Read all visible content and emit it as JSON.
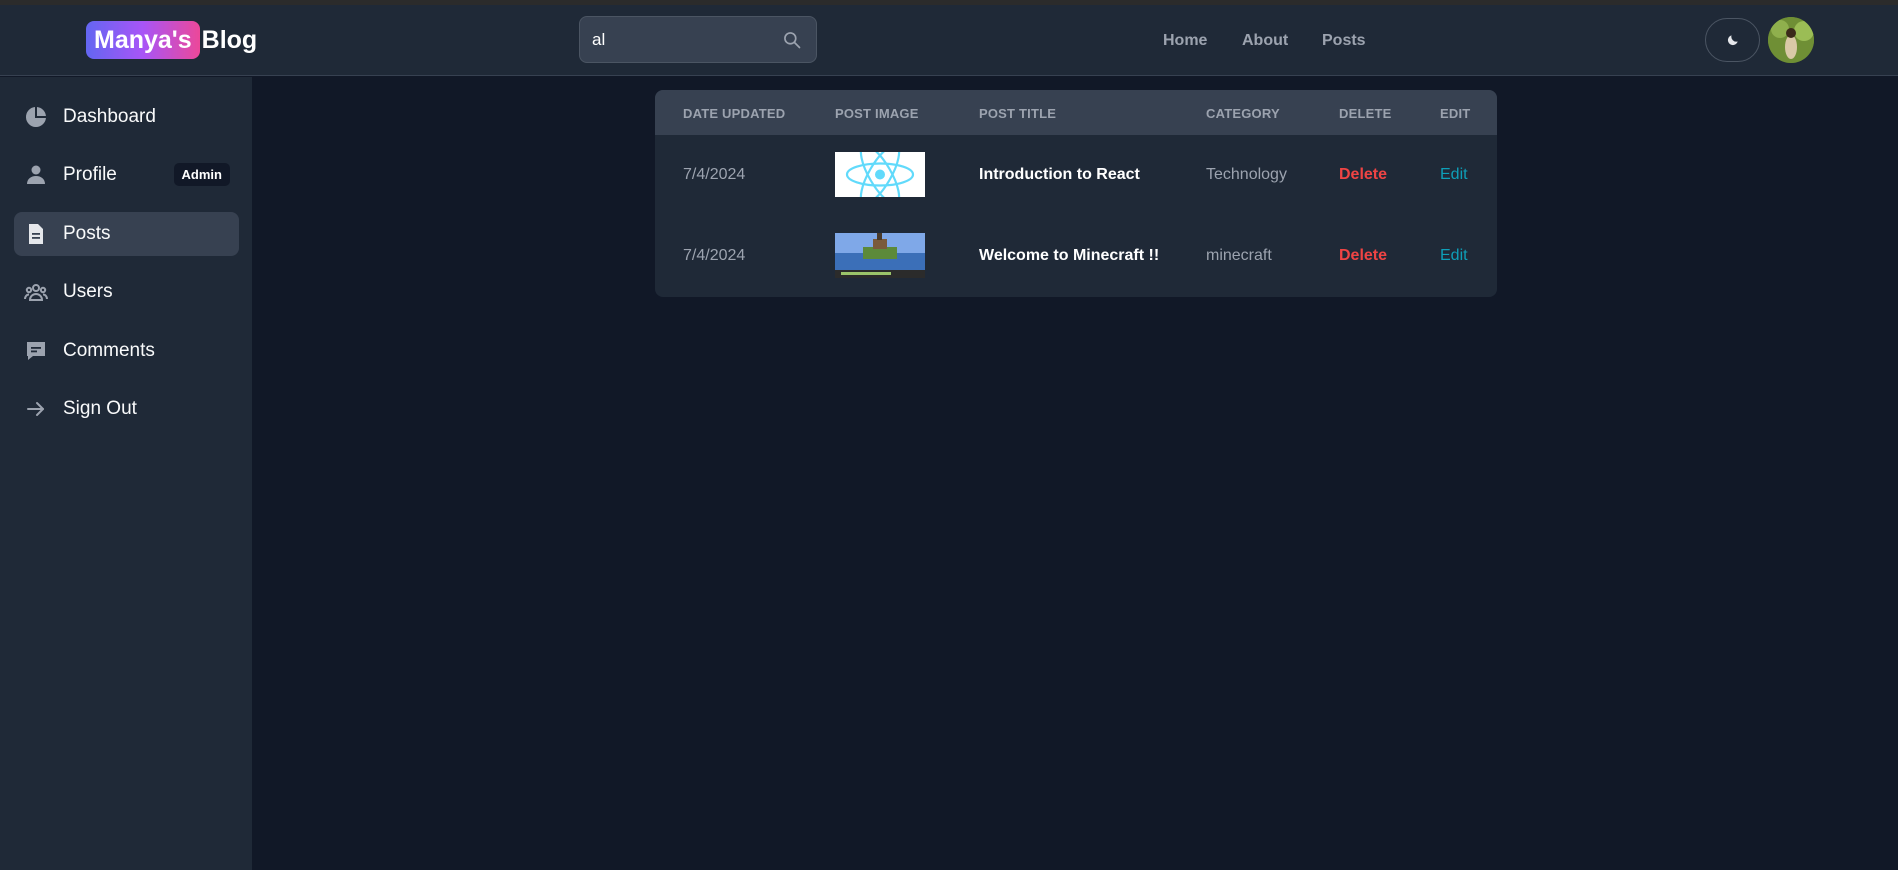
{
  "header": {
    "logo_badge": "Manya's",
    "logo_text": "Blog",
    "search": {
      "value": "al",
      "placeholder": "Search..."
    },
    "nav": [
      "Home",
      "About",
      "Posts"
    ]
  },
  "sidebar": {
    "items": [
      {
        "label": "Dashboard",
        "icon": "pie-chart-icon"
      },
      {
        "label": "Profile",
        "icon": "user-icon",
        "badge": "Admin"
      },
      {
        "label": "Posts",
        "icon": "document-icon",
        "active": true
      },
      {
        "label": "Users",
        "icon": "users-icon"
      },
      {
        "label": "Comments",
        "icon": "comment-icon"
      },
      {
        "label": "Sign Out",
        "icon": "arrow-right-icon"
      }
    ]
  },
  "table": {
    "columns": [
      "DATE UPDATED",
      "POST IMAGE",
      "POST TITLE",
      "CATEGORY",
      "DELETE",
      "EDIT"
    ],
    "rows": [
      {
        "date": "7/4/2024",
        "image": "react-logo",
        "title": "Introduction to React",
        "category": "Technology",
        "delete": "Delete",
        "edit": "Edit"
      },
      {
        "date": "7/4/2024",
        "image": "minecraft-screenshot",
        "title": "Welcome to Minecraft !!",
        "category": "minecraft",
        "delete": "Delete",
        "edit": "Edit"
      }
    ]
  },
  "colors": {
    "page_bg": "#111827",
    "panel_bg": "#1f2937",
    "delete": "#ef4444",
    "edit": "#0e9fb8"
  }
}
